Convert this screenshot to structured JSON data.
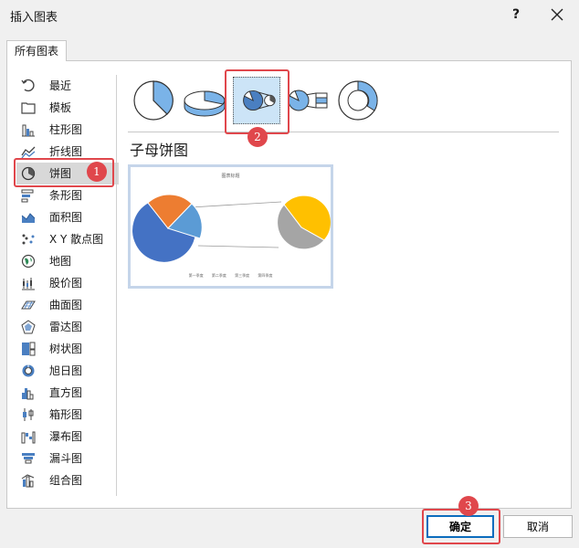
{
  "window": {
    "title": "插入图表",
    "help": "?"
  },
  "tab": {
    "label": "所有图表"
  },
  "sidebar": {
    "items": [
      {
        "label": "最近",
        "icon": "recent-icon"
      },
      {
        "label": "模板",
        "icon": "template-folder-icon"
      },
      {
        "label": "柱形图",
        "icon": "column-chart-icon"
      },
      {
        "label": "折线图",
        "icon": "line-chart-icon"
      },
      {
        "label": "饼图",
        "icon": "pie-chart-icon",
        "selected": true
      },
      {
        "label": "条形图",
        "icon": "bar-chart-icon"
      },
      {
        "label": "面积图",
        "icon": "area-chart-icon"
      },
      {
        "label": "X Y 散点图",
        "icon": "scatter-chart-icon"
      },
      {
        "label": "地图",
        "icon": "map-chart-icon"
      },
      {
        "label": "股价图",
        "icon": "stock-chart-icon"
      },
      {
        "label": "曲面图",
        "icon": "surface-chart-icon"
      },
      {
        "label": "雷达图",
        "icon": "radar-chart-icon"
      },
      {
        "label": "树状图",
        "icon": "treemap-chart-icon"
      },
      {
        "label": "旭日图",
        "icon": "sunburst-chart-icon"
      },
      {
        "label": "直方图",
        "icon": "histogram-chart-icon"
      },
      {
        "label": "箱形图",
        "icon": "box-whisker-chart-icon"
      },
      {
        "label": "瀑布图",
        "icon": "waterfall-chart-icon"
      },
      {
        "label": "漏斗图",
        "icon": "funnel-chart-icon"
      },
      {
        "label": "组合图",
        "icon": "combo-chart-icon"
      }
    ]
  },
  "subtypes": [
    {
      "icon": "pie-subtype-icon"
    },
    {
      "icon": "3d-pie-subtype-icon"
    },
    {
      "icon": "pie-of-pie-subtype-icon",
      "selected": true
    },
    {
      "icon": "bar-of-pie-subtype-icon"
    },
    {
      "icon": "doughnut-subtype-icon"
    }
  ],
  "selected_chart": {
    "name": "子母饼图",
    "preview_title": "图表标题",
    "legend": [
      "第一季度",
      "第二季度",
      "第三季度",
      "第四季度"
    ]
  },
  "buttons": {
    "ok": "确定",
    "cancel": "取消"
  },
  "annotations": [
    "1",
    "2",
    "3"
  ],
  "colors": {
    "blue": "#4472c4",
    "orange": "#ed7d31",
    "light_blue": "#5b9bd5",
    "gold": "#ffc000",
    "gray": "#a5a5a5",
    "highlight": "#e0474c",
    "accent": "#0b6cbd"
  }
}
